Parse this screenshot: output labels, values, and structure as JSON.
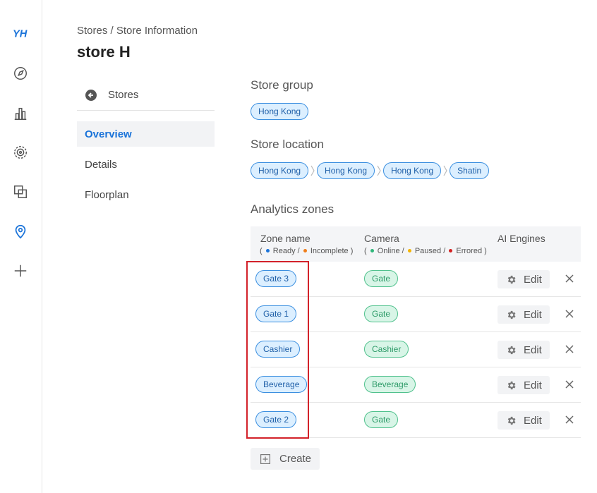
{
  "rail": {
    "items": [
      {
        "icon": "app-logo-icon",
        "label": "YH"
      },
      {
        "icon": "compass-icon"
      },
      {
        "icon": "bar-chart-icon"
      },
      {
        "icon": "radar-icon"
      },
      {
        "icon": "layers-icon"
      },
      {
        "icon": "location-pin-icon",
        "active": true
      },
      {
        "icon": "plus-icon"
      }
    ]
  },
  "header": {
    "breadcrumb": "Stores / Store Information",
    "title": "store H"
  },
  "subnav": {
    "back_label": "Stores",
    "items": [
      "Overview",
      "Details",
      "Floorplan"
    ],
    "active": "Overview"
  },
  "store_group": {
    "title": "Store group",
    "tags": [
      "Hong Kong"
    ]
  },
  "store_location": {
    "title": "Store location",
    "path": [
      "Hong Kong",
      "Hong Kong",
      "Hong Kong",
      "Shatin"
    ]
  },
  "analytics_zones": {
    "title": "Analytics zones",
    "columns": {
      "zone_name": "Zone name",
      "camera": "Camera",
      "ai_engines": "AI Engines"
    },
    "zone_legend": {
      "open": "(",
      "ready": "Ready /",
      "incomplete": "Incomplete",
      "close": ")"
    },
    "camera_legend": {
      "open": "(",
      "online": "Online /",
      "paused": "Paused /",
      "errored": "Errored",
      "close": ")"
    },
    "rows": [
      {
        "zone": "Gate 3",
        "camera": "Gate",
        "edit": "Edit"
      },
      {
        "zone": "Gate 1",
        "camera": "Gate",
        "edit": "Edit"
      },
      {
        "zone": "Cashier",
        "camera": "Cashier",
        "edit": "Edit"
      },
      {
        "zone": "Beverage",
        "camera": "Beverage",
        "edit": "Edit"
      },
      {
        "zone": "Gate 2",
        "camera": "Gate",
        "edit": "Edit"
      }
    ],
    "create_label": "Create"
  },
  "colors": {
    "accent": "#1a73d9",
    "ready": "#1a73d9",
    "incomplete": "#ef7d1a",
    "online": "#2fb67a",
    "paused": "#f5b400",
    "errored": "#d32020",
    "highlight": "#d3222a"
  }
}
